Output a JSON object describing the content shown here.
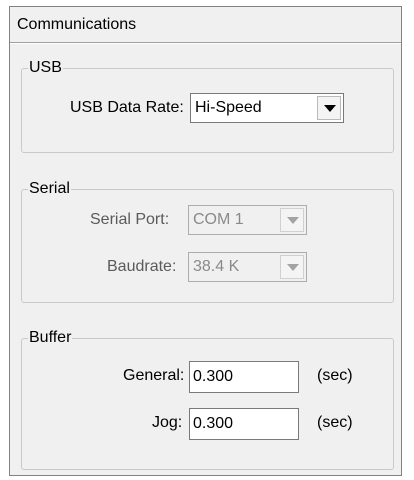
{
  "panel": {
    "title": "Communications"
  },
  "usb": {
    "group_label": "USB",
    "data_rate_label": "USB Data Rate:",
    "data_rate_value": "Hi-Speed"
  },
  "serial": {
    "group_label": "Serial",
    "port_label": "Serial Port:",
    "port_value": "COM 1",
    "baud_label": "Baudrate:",
    "baud_value": "38.4 K"
  },
  "buffer": {
    "group_label": "Buffer",
    "general_label": "General:",
    "general_value": "0.300",
    "general_unit": "(sec)",
    "jog_label": "Jog:",
    "jog_value": "0.300",
    "jog_unit": "(sec)"
  }
}
